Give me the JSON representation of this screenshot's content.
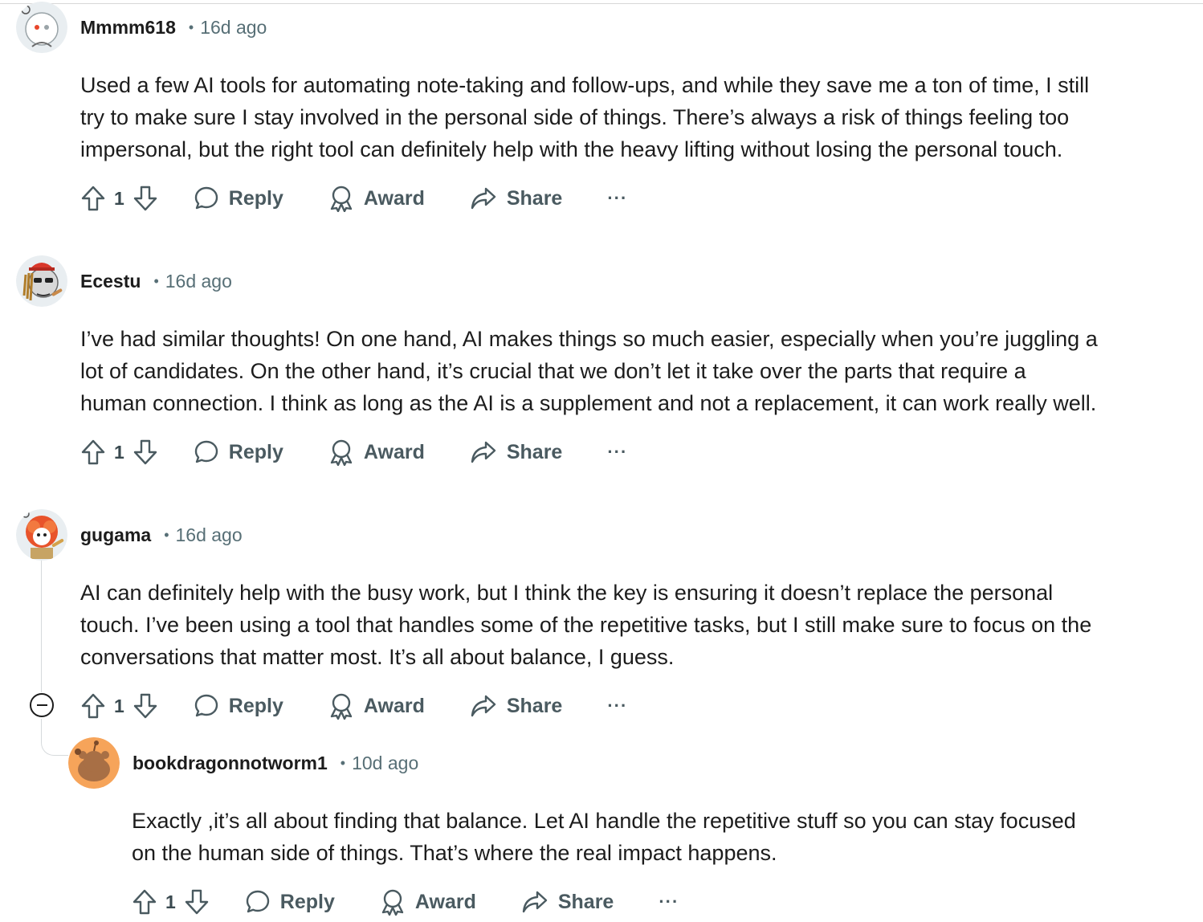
{
  "comments": [
    {
      "author": "Mmmm618",
      "age": "16d ago",
      "body": "Used a few AI tools for automating note-taking and follow-ups, and while they save me a ton of time, I still\ntry to make sure I stay involved in the personal side of things. There’s always a risk of things feeling too\nimpersonal, but the right tool can definitely help with the heavy lifting without losing the personal touch.",
      "votes": "1",
      "reply_label": "Reply",
      "award_label": "Award",
      "share_label": "Share",
      "more_label": "···"
    },
    {
      "author": "Ecestu",
      "age": "16d ago",
      "body": "I’ve had similar thoughts! On one hand, AI makes things so much easier, especially when you’re juggling a\nlot of candidates. On the other hand, it’s crucial that we don’t let it take over the parts that require a\nhuman connection. I think as long as the AI is a supplement and not a replacement, it can work really well.",
      "votes": "1",
      "reply_label": "Reply",
      "award_label": "Award",
      "share_label": "Share",
      "more_label": "···"
    },
    {
      "author": "gugama",
      "age": "16d ago",
      "body": "AI can definitely help with the busy work, but I think the key is ensuring it doesn’t replace the personal\ntouch. I’ve been using a tool that handles some of the repetitive tasks, but I still make sure to focus on the\nconversations that matter most. It’s all about balance, I guess.",
      "votes": "1",
      "reply_label": "Reply",
      "award_label": "Award",
      "share_label": "Share",
      "more_label": "···"
    },
    {
      "author": "bookdragonnotworm1",
      "age": "10d ago",
      "body": "Exactly ,it’s all about finding that balance. Let AI handle the repetitive stuff so you can stay focused\non the human side of things. That’s where the real impact happens.",
      "votes": "1",
      "reply_label": "Reply",
      "award_label": "Award",
      "share_label": "Share",
      "more_label": "···"
    }
  ],
  "separator": "•",
  "colors": {
    "text": "#1c1c1c",
    "meta": "#576f76",
    "action": "#4a5a60",
    "thread_line": "#d6dadc",
    "snoo_orange": "#f6a45a"
  },
  "icons": [
    "upvote-icon",
    "downvote-icon",
    "reply-icon",
    "award-icon",
    "share-icon",
    "more-icon",
    "collapse-icon"
  ]
}
